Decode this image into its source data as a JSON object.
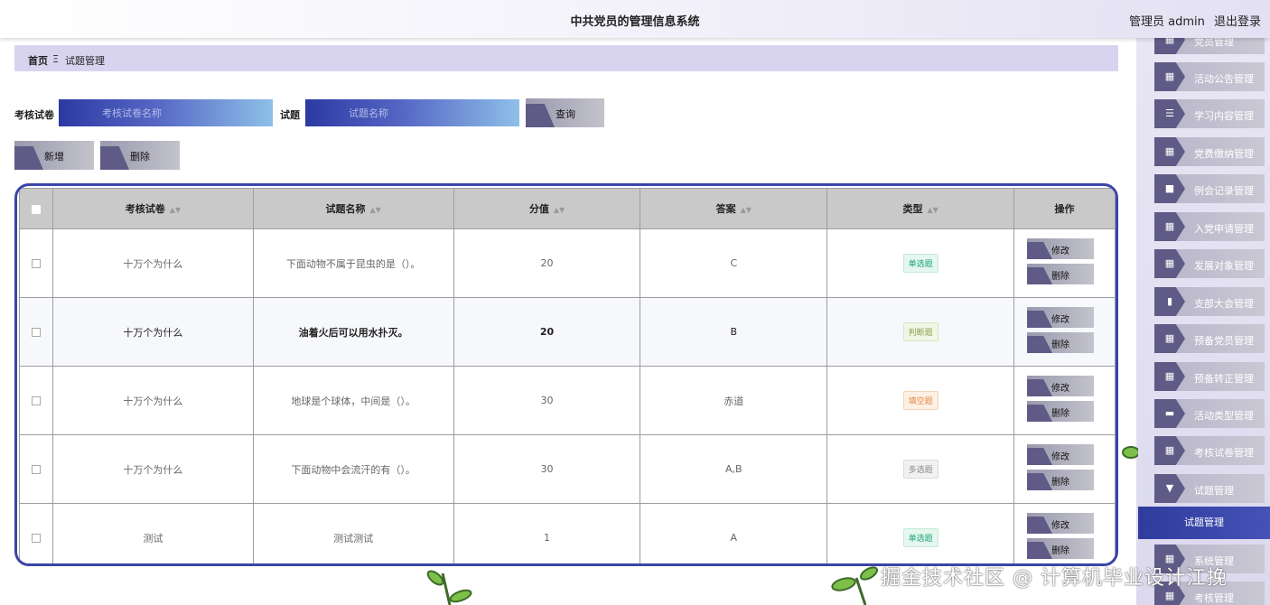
{
  "header": {
    "title": "中共党员的管理信息系统",
    "user_label": "管理员 admin",
    "logout_label": "退出登录"
  },
  "sidebar": {
    "items": [
      {
        "label": "党员管理",
        "icon": "grid-icon"
      },
      {
        "label": "活动公告管理",
        "icon": "grid-icon"
      },
      {
        "label": "学习内容管理",
        "icon": "list-icon"
      },
      {
        "label": "党费缴纳管理",
        "icon": "grid-icon"
      },
      {
        "label": "例会记录管理",
        "icon": "folder-icon"
      },
      {
        "label": "入党申请管理",
        "icon": "grid-icon"
      },
      {
        "label": "发展对象管理",
        "icon": "grid-icon"
      },
      {
        "label": "支部大会管理",
        "icon": "book-icon"
      },
      {
        "label": "预备党员管理",
        "icon": "grid-icon"
      },
      {
        "label": "预备转正管理",
        "icon": "grid-icon"
      },
      {
        "label": "活动类型管理",
        "icon": "monitor-icon"
      },
      {
        "label": "考核试卷管理",
        "icon": "grid-icon"
      },
      {
        "label": "试题管理",
        "icon": "funnel-icon"
      }
    ],
    "active_sub": "试题管理",
    "more_items": [
      {
        "label": "系统管理",
        "icon": "grid-icon"
      },
      {
        "label": "考核管理",
        "icon": "grid-icon"
      }
    ]
  },
  "breadcrumb": {
    "home": "首页",
    "separator": "Ξ",
    "current": "试题管理"
  },
  "search": {
    "paper_label": "考核试卷",
    "paper_placeholder": "考核试卷名称",
    "question_label": "试题",
    "question_placeholder": "试题名称",
    "query_label": "查询"
  },
  "toolbar": {
    "add_label": "新增",
    "delete_label": "删除"
  },
  "table": {
    "columns": [
      "考核试卷",
      "试题名称",
      "分值",
      "答案",
      "类型",
      "操作"
    ],
    "rows": [
      {
        "paper": "十万个为什么",
        "question": "下面动物不属于昆虫的是（）。",
        "score": "20",
        "answer": "C",
        "type": "单选题",
        "tag": "single"
      },
      {
        "paper": "十万个为什么",
        "question": "油着火后可以用水扑灭。",
        "score": "20",
        "answer": "B",
        "type": "判断题",
        "tag": "judge"
      },
      {
        "paper": "十万个为什么",
        "question": "地球是个球体，中间是（）。",
        "score": "30",
        "answer": "赤道",
        "type": "填空题",
        "tag": "fill"
      },
      {
        "paper": "十万个为什么",
        "question": "下面动物中会流汗的有（）。",
        "score": "30",
        "answer": "A,B",
        "type": "多选题",
        "tag": "multi"
      },
      {
        "paper": "测试",
        "question": "测试测试",
        "score": "1",
        "answer": "A",
        "type": "单选题",
        "tag": "single"
      }
    ],
    "edit_label": "修改",
    "delete_label": "删除"
  },
  "watermark": "掘金技术社区 @ 计算机毕业设计江挽",
  "colors": {
    "accent": "#3a45a8",
    "tab": "#5f5b86",
    "breadcrumb_bg": "#d8d4ef"
  }
}
